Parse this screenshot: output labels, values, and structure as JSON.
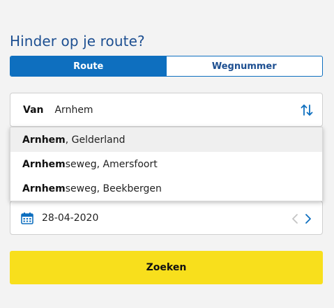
{
  "header": {
    "title": "Hinder op je route?"
  },
  "tabs": [
    {
      "label": "Route",
      "active": true
    },
    {
      "label": "Wegnummer",
      "active": false
    }
  ],
  "route": {
    "from_label": "Van",
    "from_value": "Arnhem",
    "suggestions": [
      {
        "match": "Arnhem",
        "rest": ", Gelderland"
      },
      {
        "match": "Arnhem",
        "rest": "seweg, Amersfoort"
      },
      {
        "match": "Arnhem",
        "rest": "seweg, Beekbergen"
      }
    ]
  },
  "date": {
    "value": "28-04-2020"
  },
  "search_button": {
    "label": "Zoeken"
  },
  "colors": {
    "accent": "#0e6fbf",
    "title": "#1d4f91",
    "button": "#f8df1c",
    "background": "#f3f3f3"
  },
  "icons": [
    "swap-arrows-icon",
    "calendar-icon",
    "chevron-left-icon",
    "chevron-right-icon"
  ]
}
